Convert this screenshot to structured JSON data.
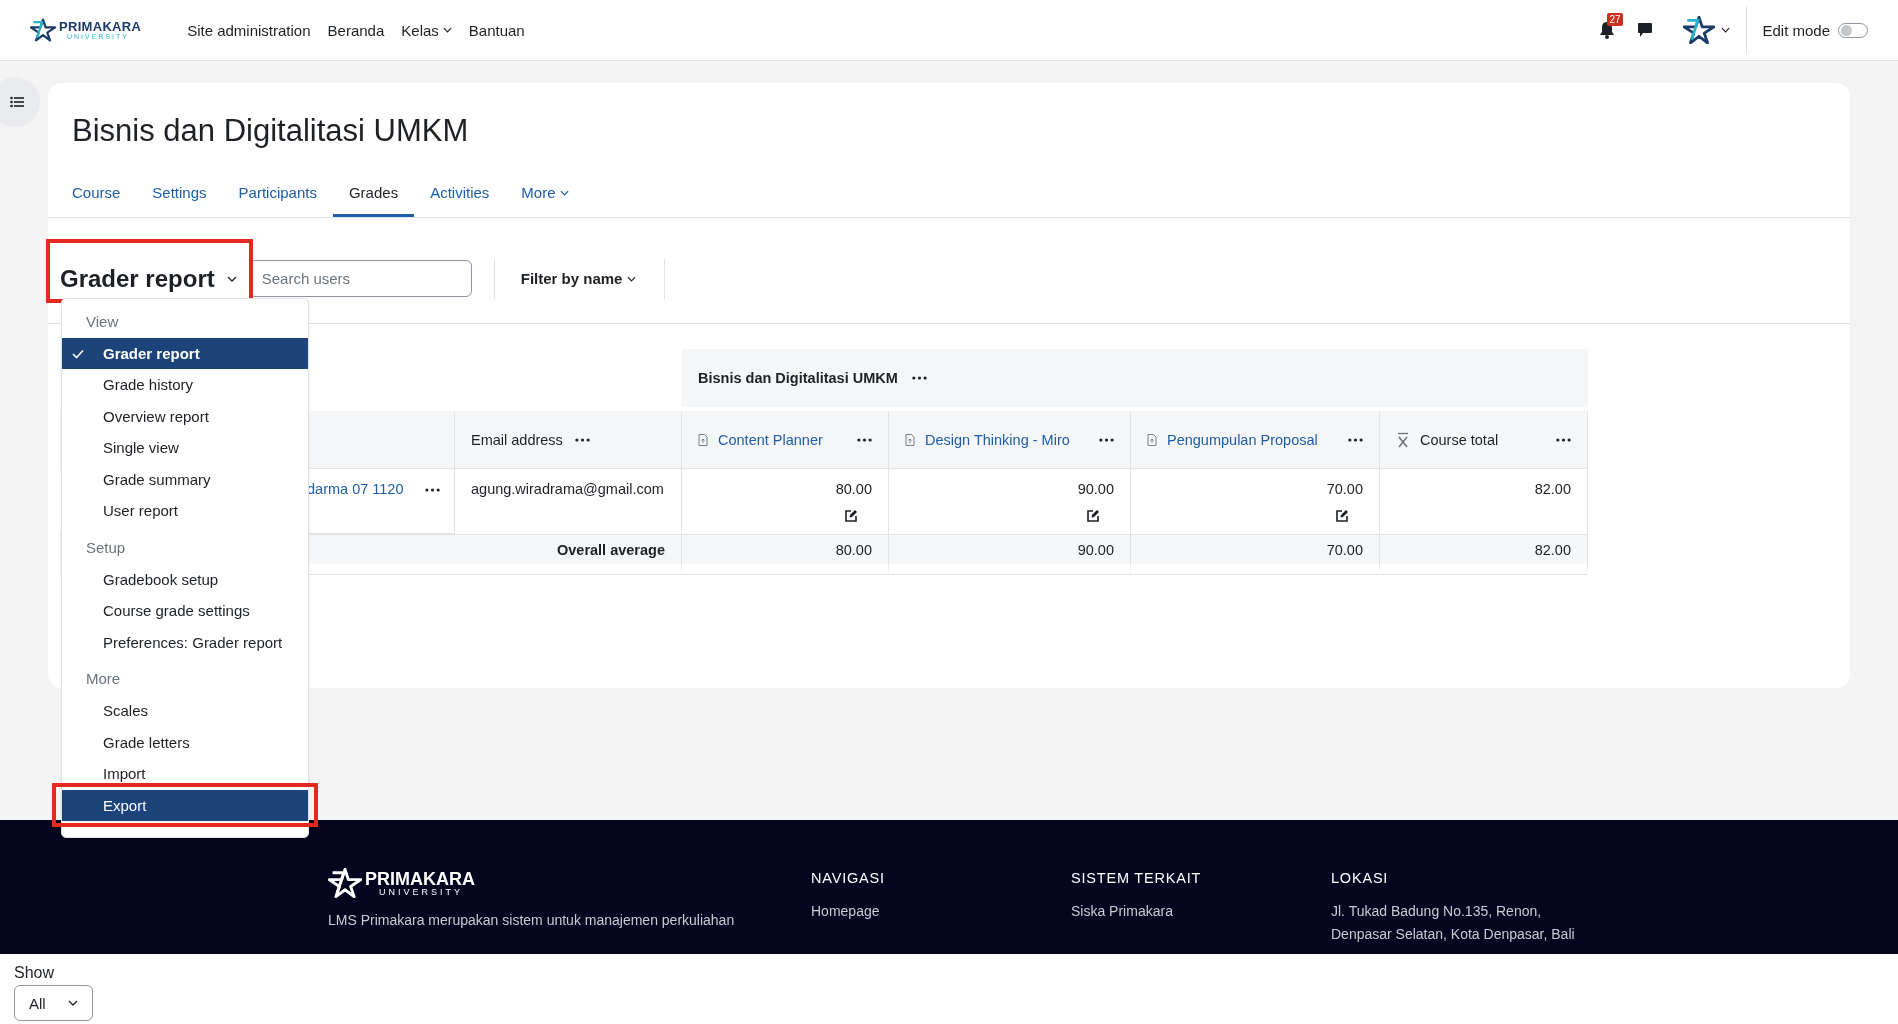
{
  "topbar": {
    "logo": {
      "name": "PRIMAKARA",
      "subtitle": "UNIVERSITY"
    },
    "nav": [
      {
        "label": "Site administration",
        "dropdown": false
      },
      {
        "label": "Beranda",
        "dropdown": false
      },
      {
        "label": "Kelas",
        "dropdown": true
      },
      {
        "label": "Bantuan",
        "dropdown": false
      }
    ],
    "notification_count": "27",
    "edit_mode": {
      "label": "Edit mode",
      "on": false
    }
  },
  "course": {
    "title": "Bisnis dan Digitalitasi UMKM",
    "tabs": [
      {
        "label": "Course",
        "selected": false,
        "dropdown": false
      },
      {
        "label": "Settings",
        "selected": false,
        "dropdown": false
      },
      {
        "label": "Participants",
        "selected": false,
        "dropdown": false
      },
      {
        "label": "Grades",
        "selected": true,
        "dropdown": false
      },
      {
        "label": "Activities",
        "selected": false,
        "dropdown": false
      },
      {
        "label": "More",
        "selected": false,
        "dropdown": true
      }
    ]
  },
  "toolbar": {
    "report_selector": "Grader report",
    "search": {
      "placeholder": "Search users"
    },
    "filter": "Filter by name"
  },
  "report_menu": {
    "sections": [
      {
        "heading": "View",
        "items": [
          {
            "label": "Grader report",
            "selected": true,
            "highlighted": false
          },
          {
            "label": "Grade history",
            "selected": false,
            "highlighted": false
          },
          {
            "label": "Overview report",
            "selected": false,
            "highlighted": false
          },
          {
            "label": "Single view",
            "selected": false,
            "highlighted": false
          },
          {
            "label": "Grade summary",
            "selected": false,
            "highlighted": false
          },
          {
            "label": "User report",
            "selected": false,
            "highlighted": false
          }
        ]
      },
      {
        "heading": "Setup",
        "items": [
          {
            "label": "Gradebook setup",
            "selected": false,
            "highlighted": false
          },
          {
            "label": "Course grade settings",
            "selected": false,
            "highlighted": false
          },
          {
            "label": "Preferences: Grader report",
            "selected": false,
            "highlighted": false
          }
        ]
      },
      {
        "heading": "More",
        "items": [
          {
            "label": "Scales",
            "selected": false,
            "highlighted": false
          },
          {
            "label": "Grade letters",
            "selected": false,
            "highlighted": false
          },
          {
            "label": "Import",
            "selected": false,
            "highlighted": false
          },
          {
            "label": "Export",
            "selected": false,
            "highlighted": true
          }
        ]
      }
    ]
  },
  "table": {
    "category": "Bisnis dan Digitalitasi UMKM",
    "columns": [
      {
        "kind": "email",
        "label": "Email address"
      },
      {
        "kind": "assignment",
        "label": "Content Planner"
      },
      {
        "kind": "assignment",
        "label": "Design Thinking - Miro"
      },
      {
        "kind": "assignment",
        "label": "Pengumpulan Proposal"
      },
      {
        "kind": "total",
        "label": "Course total"
      }
    ],
    "rows": [
      {
        "name": "darma 07 1120",
        "email": "agung.wiradrama@gmail.com",
        "grades": [
          "80.00",
          "90.00",
          "70.00",
          "82.00"
        ]
      }
    ],
    "average": {
      "label": "Overall average",
      "values": [
        "80.00",
        "90.00",
        "70.00",
        "82.00"
      ]
    }
  },
  "footer": {
    "logo": {
      "name": "PRIMAKARA",
      "subtitle": "UNIVERSITY"
    },
    "description": "LMS Primakara merupakan sistem untuk manajemen perkuliahan",
    "columns": [
      {
        "heading": "NAVIGASI",
        "items": [
          "Homepage"
        ]
      },
      {
        "heading": "SISTEM TERKAIT",
        "items": [
          "Siska Primakara"
        ]
      },
      {
        "heading": "LOKASI",
        "items": [
          "Jl. Tukad Badung No.135, Renon,",
          "Denpasar Selatan, Kota Denpasar, Bali"
        ]
      }
    ]
  },
  "show": {
    "label": "Show",
    "value": "All"
  }
}
